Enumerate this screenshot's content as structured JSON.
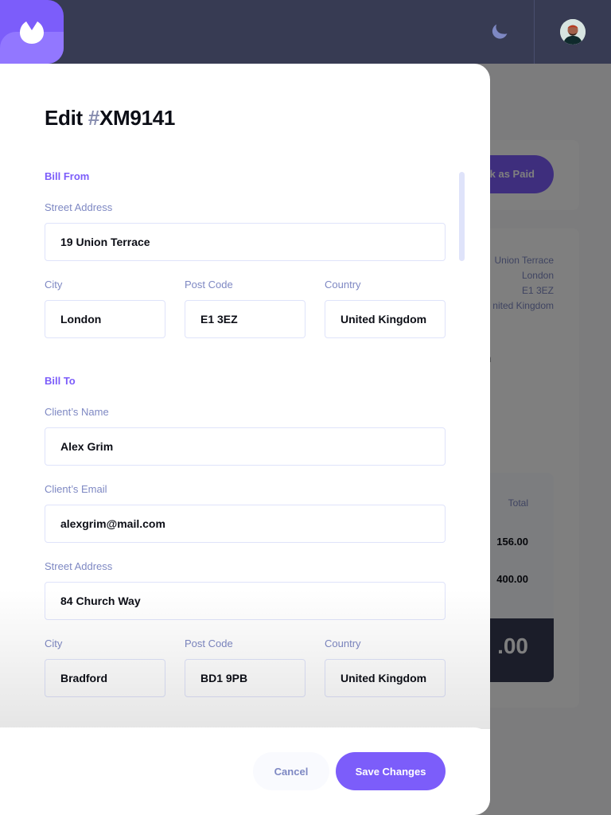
{
  "header": {
    "logo_icon": "brand-logo-icon",
    "theme_icon": "moon-icon",
    "avatar_icon": "user-avatar"
  },
  "background": {
    "mark_paid_label": "k as Paid",
    "sender_address": [
      "Union Terrace",
      "London",
      "E1 3EZ",
      "nited Kingdom"
    ],
    "client_name_fragment": "m",
    "total_header": "Total",
    "item_totals": [
      "156.00",
      "400.00"
    ],
    "amount_due_fragment": ".00"
  },
  "drawer": {
    "title_prefix": "Edit ",
    "title_hash": "#",
    "title_id": "XM9141",
    "bill_from": {
      "heading": "Bill From",
      "street_label": "Street Address",
      "street_value": "19 Union Terrace",
      "city_label": "City",
      "city_value": "London",
      "postcode_label": "Post Code",
      "postcode_value": "E1 3EZ",
      "country_label": "Country",
      "country_value": "United Kingdom"
    },
    "bill_to": {
      "heading": "Bill To",
      "client_name_label": "Client’s Name",
      "client_name_value": "Alex Grim",
      "client_email_label": "Client’s Email",
      "client_email_value": "alexgrim@mail.com",
      "street_label": "Street Address",
      "street_value": "84 Church Way",
      "city_label": "City",
      "city_value": "Bradford",
      "postcode_label": "Post Code",
      "postcode_value": "BD1 9PB",
      "country_label": "Country",
      "country_value": "United Kingdom"
    },
    "cancel_label": "Cancel",
    "save_label": "Save Changes"
  },
  "colors": {
    "accent": "#7c5dfa",
    "header_bg": "#373b53",
    "label": "#7e88c3"
  }
}
